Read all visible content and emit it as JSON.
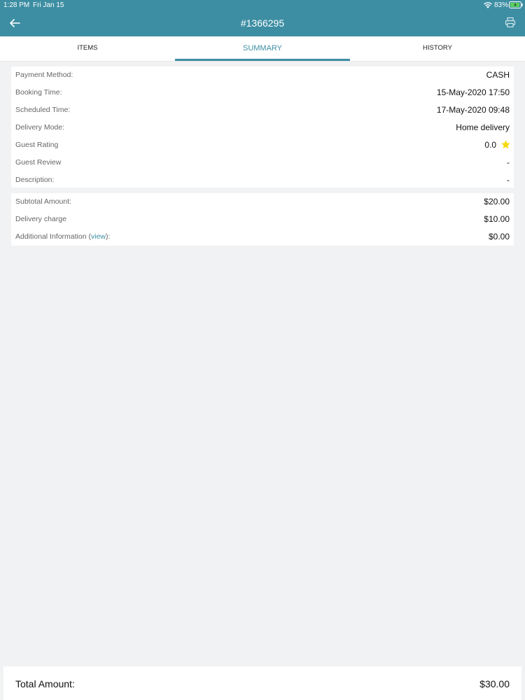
{
  "status_bar": {
    "time": "1:28 PM",
    "date": "Fri Jan 15",
    "battery": "83%"
  },
  "header": {
    "title": "#1366295"
  },
  "tabs": [
    {
      "label": "ITEMS"
    },
    {
      "label": "SUMMARY"
    },
    {
      "label": "HISTORY"
    }
  ],
  "details": {
    "payment_method": {
      "label": "Payment Method:",
      "value": "CASH"
    },
    "booking_time": {
      "label": "Booking Time:",
      "value": "15-May-2020 17:50"
    },
    "scheduled_time": {
      "label": "Scheduled Time:",
      "value": "17-May-2020 09:48"
    },
    "delivery_mode": {
      "label": "Delivery Mode:",
      "value": "Home delivery"
    },
    "guest_rating": {
      "label": "Guest Rating",
      "value": "0.0",
      "star_color": "#f5d90a"
    },
    "guest_review": {
      "label": "Guest Review",
      "value": "-"
    },
    "description": {
      "label": "Description:",
      "value": "-"
    }
  },
  "amounts": {
    "subtotal": {
      "label": "Subtotal Amount:",
      "value": "$20.00"
    },
    "delivery_charge": {
      "label": "Delivery charge",
      "value": "$10.00"
    },
    "additional_info": {
      "label_prefix": "Additional Information (",
      "link": "view",
      "label_suffix": "):",
      "value": "$0.00"
    }
  },
  "total": {
    "label": "Total Amount:",
    "value": "$30.00"
  },
  "colors": {
    "accent": "#3d8ea3",
    "background": "#f1f2f3"
  }
}
